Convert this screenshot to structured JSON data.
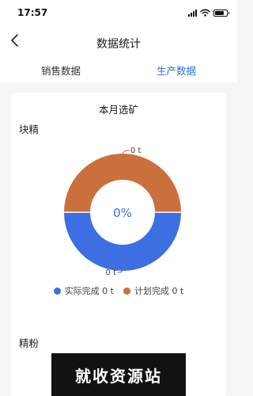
{
  "status_bar": {
    "time": "17:57"
  },
  "nav": {
    "title": "数据统计",
    "back_icon": "chevron-left-icon"
  },
  "tabs": [
    {
      "label": "销售数据",
      "active": false
    },
    {
      "label": "生产数据",
      "active": true
    }
  ],
  "card": {
    "title": "本月选矿",
    "block_label": "块精",
    "powder_label": "精粉"
  },
  "chart_data": {
    "type": "pie",
    "center_label": "0%",
    "slices": [
      {
        "name": "实际完成",
        "value": 0,
        "unit": "t",
        "color": "#3d6fe3",
        "label": "0 t"
      },
      {
        "name": "计划完成",
        "value": 0,
        "unit": "t",
        "color": "#c9703d",
        "label": "0 t"
      }
    ],
    "legend": [
      "实际完成 0 t",
      "计划完成 0 t"
    ]
  },
  "watermark": "就收资源站",
  "colors": {
    "accent": "#2a6fe0",
    "actual": "#3d6fe3",
    "plan": "#c9703d"
  }
}
